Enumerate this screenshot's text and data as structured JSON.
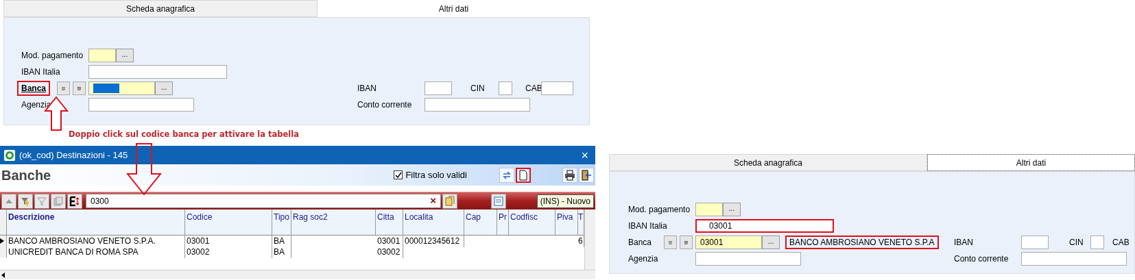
{
  "forms": [
    {
      "tabs": [
        {
          "label": "Scheda anagrafica",
          "selected": false
        },
        {
          "label": "Altri dati",
          "selected": true
        }
      ],
      "mod_pagamento": {
        "label": "Mod. pagamento",
        "browse_button": "..."
      },
      "iban_italia": {
        "label": "IBAN Italia",
        "highlighted": false
      },
      "banca": {
        "label": "Banca",
        "link": true,
        "label_highlighted": true,
        "value_selected": true,
        "browse_button": "..."
      },
      "agenzia": {
        "label": "Agenzia"
      },
      "iban": {
        "label": "IBAN"
      },
      "cin": {
        "label": "CIN"
      },
      "cab": {
        "label": "CAB"
      },
      "conto_corrente": {
        "label": "Conto corrente"
      }
    },
    {
      "tabs": [
        {
          "label": "Scheda anagrafica",
          "selected": false
        },
        {
          "label": "Altri dati",
          "selected": true
        }
      ],
      "mod_pagamento": {
        "label": "Mod. pagamento",
        "browse_button": "..."
      },
      "iban_italia": {
        "label": "IBAN Italia",
        "value": "03001",
        "highlighted": true
      },
      "banca": {
        "label": "Banca",
        "link": false,
        "label_highlighted": false,
        "value": "03001",
        "browse_button": "...",
        "description": "BANCO AMBROSIANO VENETO S.P.A",
        "description_highlighted": true
      },
      "agenzia": {
        "label": "Agenzia"
      },
      "iban": {
        "label": "IBAN"
      },
      "cin": {
        "label": "CIN"
      },
      "cab": {
        "label": "CAB"
      },
      "conto_corrente": {
        "label": "Conto corrente"
      }
    }
  ],
  "annotation": {
    "text": "Doppio click sul codice banca per attivare la tabella"
  },
  "dialog": {
    "title": "(ok_cod) Destinazioni - 145",
    "close": "×",
    "heading": "Banche",
    "filter": {
      "label": "Filtra solo validi",
      "checked": true
    },
    "new_button_highlighted": true,
    "search": {
      "value": "0300",
      "clear": "×"
    },
    "tooltip": "(INS) - Nuovo",
    "columns": [
      "Descrizione",
      "Codice",
      "Tipo",
      "Rag soc2",
      "Citta",
      "Localita",
      "Cap",
      "Pr",
      "Codfisc",
      "Piva",
      "T"
    ],
    "rows": [
      {
        "selected": true,
        "cells": [
          "BANCO AMBROSIANO VENETO S.P.A.",
          "03001",
          "BA",
          null,
          "03001",
          "000012345612",
          null,
          null,
          null,
          null,
          "6"
        ]
      },
      {
        "selected": false,
        "cells": [
          "UNICREDIT BANCA DI ROMA SPA",
          "03002",
          "BA",
          null,
          "03002",
          null,
          null,
          null,
          null,
          null,
          null
        ]
      }
    ]
  }
}
